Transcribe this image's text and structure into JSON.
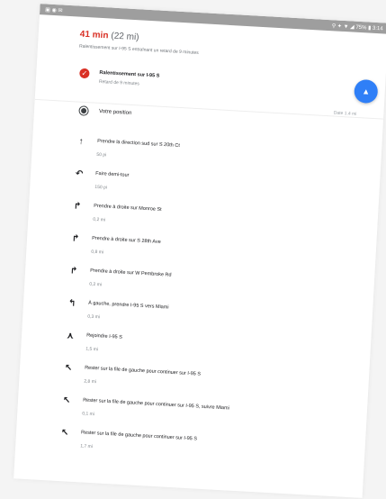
{
  "status_bar": {
    "left": "▣ ◉ ✉",
    "right": "⚲ ✦ ▼ ◢ 75% ▮ 3:14"
  },
  "route": {
    "eta": "41 min",
    "distance": "(22 mi)",
    "note": "Ralentissement sur I-95 S entraînant un retard de 9 minutes"
  },
  "alert": {
    "title": "Ralentissement sur I-95 S",
    "subtitle": "Retard de 9 minutes",
    "icon": "alert-icon"
  },
  "date_label": "Date 1.4 mi",
  "position": {
    "label": "Votre position",
    "icon": "location-dot-icon"
  },
  "steps": [
    {
      "icon": "straight-arrow-icon",
      "glyph": "↑",
      "text": "Prendre la direction sud sur S 20th Ct",
      "dist": "50 pi"
    },
    {
      "icon": "u-turn-icon",
      "glyph": "↶",
      "text": "Faire demi-tour",
      "dist": "150 pi"
    },
    {
      "icon": "turn-right-icon",
      "glyph": "↱",
      "text": "Prendre à droite sur Monroe St",
      "dist": "0,2 mi"
    },
    {
      "icon": "turn-right-icon",
      "glyph": "↱",
      "text": "Prendre à droite sur S 28th Ave",
      "dist": "0,8 mi"
    },
    {
      "icon": "turn-right-icon",
      "glyph": "↱",
      "text": "Prendre à droite sur W Pembroke Rd",
      "dist": "0,2 mi"
    },
    {
      "icon": "turn-left-icon",
      "glyph": "↰",
      "text": "À gauche, prendre I-95 S vers Miami",
      "dist": "0,3 mi"
    },
    {
      "icon": "merge-icon",
      "glyph": "⋏",
      "text": "Rejoindre I-95 S",
      "dist": "1,5 mi"
    },
    {
      "icon": "keep-left-icon",
      "glyph": "↖",
      "text": "Rester sur la file de gauche pour continuer sur I-95 S",
      "dist": "2,8 mi"
    },
    {
      "icon": "keep-left-icon",
      "glyph": "↖",
      "text": "Rester sur la file de gauche pour continuer sur I-95 S, suivre Miami",
      "dist": "0,1 mi"
    },
    {
      "icon": "keep-left-icon",
      "glyph": "↖",
      "text": "Rester sur la file de gauche pour continuer sur I-95 S",
      "dist": "1,7 mi"
    }
  ],
  "colors": {
    "eta": "#d93025",
    "accent": "#2f7ff7",
    "alert": "#d93025"
  }
}
